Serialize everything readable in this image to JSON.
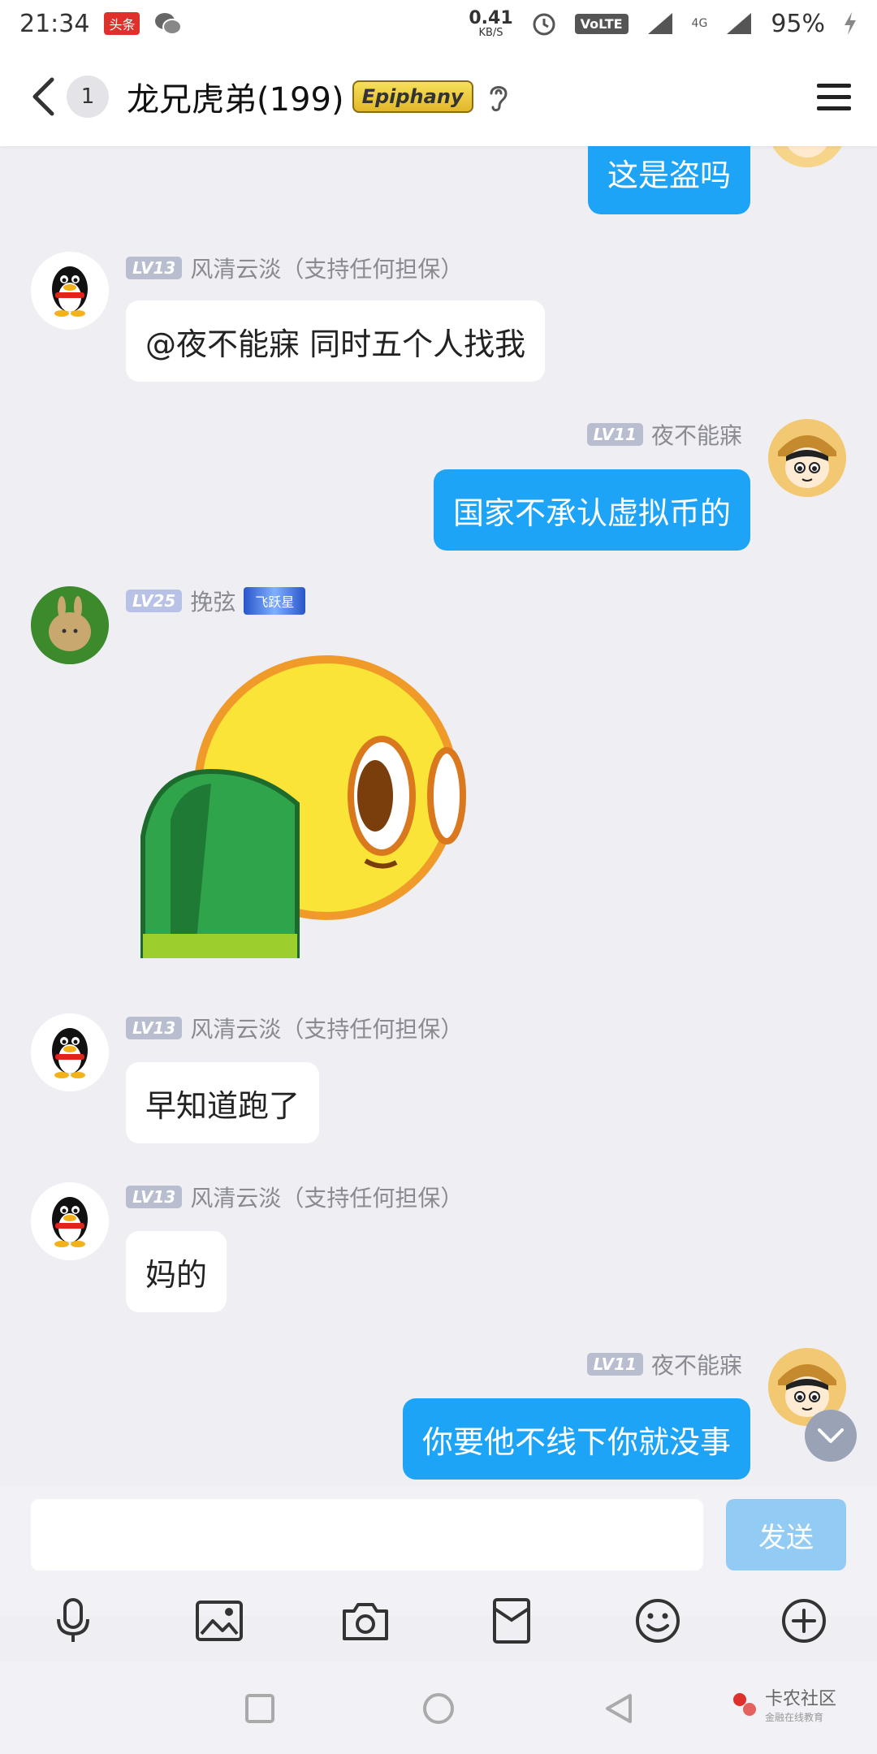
{
  "status_bar": {
    "time": "21:34",
    "news_badge": "头条",
    "speed_value": "0.41",
    "speed_unit": "KB/S",
    "volte": "VoLTE",
    "network": "4G",
    "battery": "95%"
  },
  "header": {
    "unread_count": "1",
    "title": "龙兄虎弟(199)",
    "title_badge": "Epiphany"
  },
  "messages": [
    {
      "direction": "out",
      "text": "这是盗吗"
    },
    {
      "direction": "in",
      "level": "LV13",
      "name": "风清云淡（支持任何担保）",
      "text": "@夜不能寐 同时五个人找我"
    },
    {
      "direction": "out",
      "level": "LV11",
      "name": "夜不能寐",
      "text": "国家不承认虚拟币的"
    },
    {
      "direction": "in",
      "level": "LV25",
      "name": "挽弦",
      "tag": "飞跃星",
      "type": "sticker"
    },
    {
      "direction": "in",
      "level": "LV13",
      "name": "风清云淡（支持任何担保）",
      "text": "早知道跑了"
    },
    {
      "direction": "in",
      "level": "LV13",
      "name": "风清云淡（支持任何担保）",
      "text": "妈的"
    },
    {
      "direction": "out",
      "level": "LV11",
      "name": "夜不能寐",
      "text": "你要他不线下你就没事"
    }
  ],
  "composer": {
    "input_value": "",
    "send_label": "发送"
  },
  "toolbar_icons": [
    "microphone-icon",
    "image-icon",
    "camera-icon",
    "red-packet-icon",
    "emoji-icon",
    "plus-icon"
  ],
  "watermark": {
    "name": "卡农社区",
    "sub": "金融在线教育"
  },
  "colors": {
    "outgoing_bubble": "#1ea4f7",
    "background": "#eeeef3",
    "send_button": "#92ccf4"
  }
}
